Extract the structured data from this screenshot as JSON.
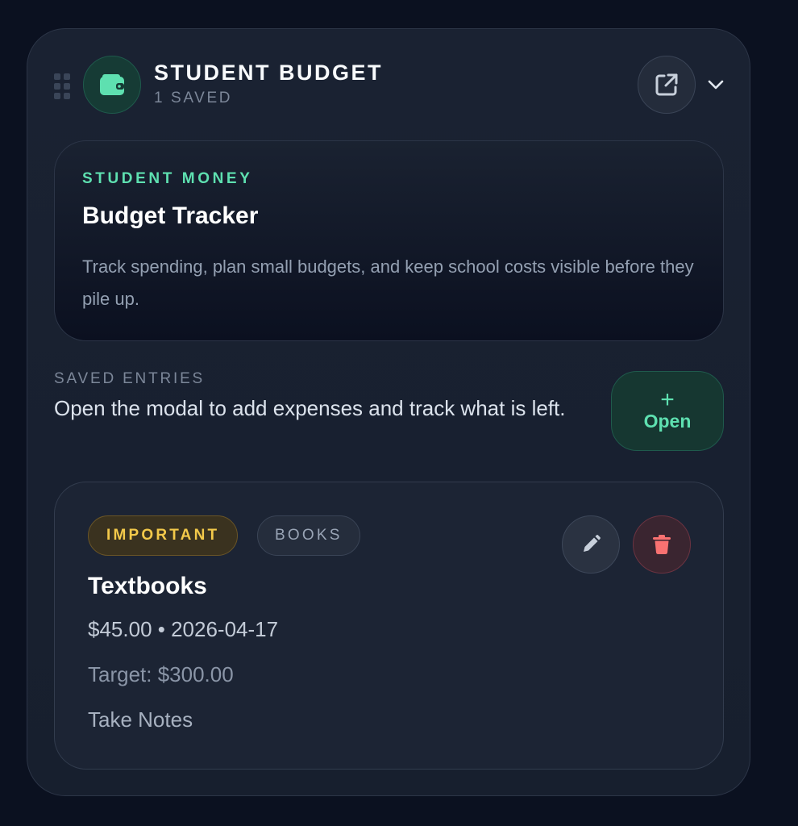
{
  "header": {
    "title": "STUDENT BUDGET",
    "subtitle": "1 SAVED",
    "icons": {
      "app": "wallet-icon",
      "external": "external-link-icon",
      "collapse": "chevron-down-icon",
      "drag": "drag-handle-icon"
    },
    "accent_color": "#5ee0b0"
  },
  "hero": {
    "kicker": "STUDENT MONEY",
    "title": "Budget Tracker",
    "description": "Track spending, plan small budgets, and keep school costs visible before they pile up."
  },
  "saved": {
    "label": "SAVED ENTRIES",
    "description": "Open the modal to add expenses and track what is left.",
    "open_button": {
      "icon": "+",
      "label": "Open"
    }
  },
  "entry": {
    "tags": [
      {
        "label": "IMPORTANT",
        "color": "#f3c94a"
      },
      {
        "label": "BOOKS",
        "color": "#9aa5b6"
      }
    ],
    "title": "Textbooks",
    "meta": "$45.00 • 2026-04-17",
    "target": "Target: $300.00",
    "note": "Take Notes",
    "icons": {
      "edit": "pencil-icon",
      "delete": "trash-icon"
    },
    "delete_color": "#f87171"
  }
}
